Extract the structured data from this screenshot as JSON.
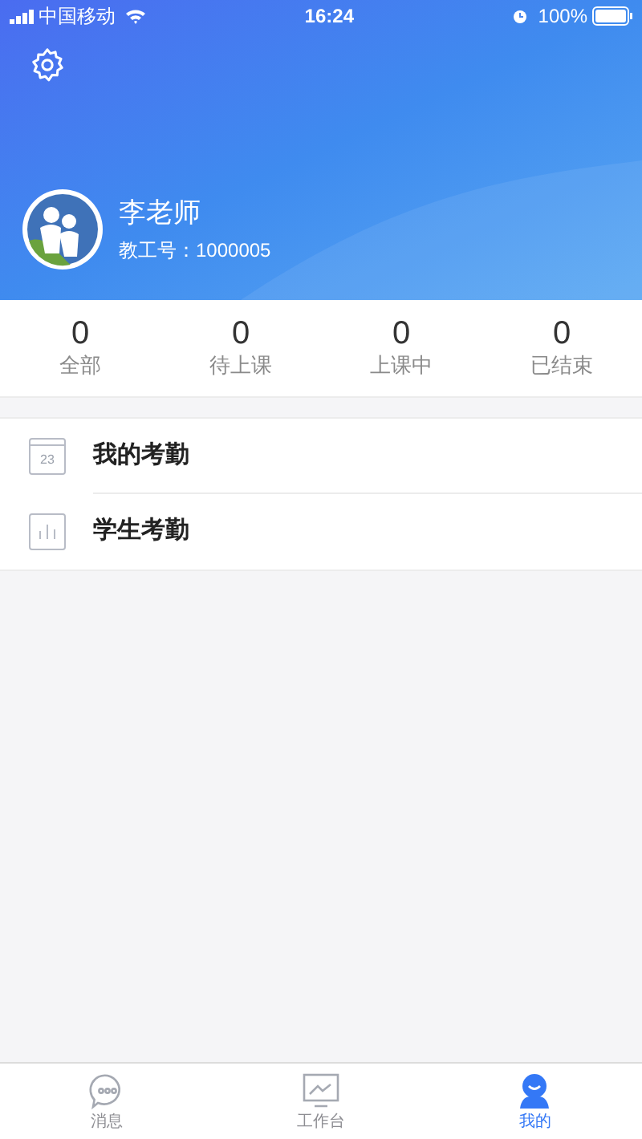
{
  "status_bar": {
    "carrier": "中国移动",
    "time": "16:24",
    "battery": "100%"
  },
  "profile": {
    "name": "李老师",
    "staff_id": "教工号：1000005"
  },
  "stats": [
    {
      "value": "0",
      "label": "全部"
    },
    {
      "value": "0",
      "label": "待上课"
    },
    {
      "value": "0",
      "label": "上课中"
    },
    {
      "value": "0",
      "label": "已结束"
    }
  ],
  "menu": [
    {
      "kind": "calendar",
      "icon_text": "23",
      "label": "我的考勤"
    },
    {
      "kind": "chart",
      "label": "学生考勤"
    }
  ],
  "tab_bar": [
    {
      "kind": "chat",
      "label": "消息",
      "selected": false
    },
    {
      "kind": "monitor",
      "label": "工作台",
      "selected": false
    },
    {
      "kind": "person",
      "label": "我的",
      "selected": true
    }
  ]
}
